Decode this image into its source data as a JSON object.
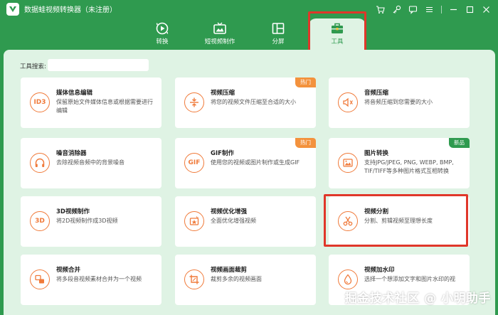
{
  "app": {
    "title": "数据蛙视频转换器（未注册）",
    "window_controls": [
      "cart-icon",
      "key-icon",
      "chat-icon",
      "menu-icon",
      "minimize-icon",
      "maximize-icon",
      "close-icon"
    ]
  },
  "nav": {
    "tabs": [
      {
        "label": "转换",
        "icon": "convert-icon",
        "active": false
      },
      {
        "label": "短视频制作",
        "icon": "tv-icon",
        "active": false
      },
      {
        "label": "分屏",
        "icon": "split-screen-icon",
        "active": false
      },
      {
        "label": "工具",
        "icon": "toolbox-icon",
        "active": true
      }
    ]
  },
  "search": {
    "label": "工具搜索:",
    "value": ""
  },
  "tools": [
    {
      "title": "媒体信息编辑",
      "desc": "保留原始文件媒体信息或根据需要进行编辑",
      "icon": "id3-icon",
      "icon_text": "ID3",
      "badge": ""
    },
    {
      "title": "视频压缩",
      "desc": "将您的视频文件压缩至合适的大小",
      "icon": "compress-icon",
      "icon_text": "",
      "badge": "热门"
    },
    {
      "title": "音频压缩",
      "desc": "将音频压缩到您需要的大小",
      "icon": "audio-compress-icon",
      "icon_text": "",
      "badge": ""
    },
    {
      "title": "噪音消除器",
      "desc": "去除视频音频中的背景噪音",
      "icon": "headphones-icon",
      "icon_text": "",
      "badge": ""
    },
    {
      "title": "GIF制作",
      "desc": "使用您的视频或图片制作或生成GIF",
      "icon": "gif-icon",
      "icon_text": "GIF",
      "badge": "热门"
    },
    {
      "title": "图片转换",
      "desc": "支持JPG/JPEG, PNG, WEBP, BMP, TIF/TIFF等多种图片格式互相转换",
      "icon": "image-convert-icon",
      "icon_text": "",
      "badge": "新品"
    },
    {
      "title": "3D视频制作",
      "desc": "将2D视频制作成3D视频",
      "icon": "3d-icon",
      "icon_text": "3D",
      "badge": ""
    },
    {
      "title": "视频优化增强",
      "desc": "全面优化增强视频",
      "icon": "enhance-icon",
      "icon_text": "",
      "badge": ""
    },
    {
      "title": "视频分割",
      "desc": "分割、剪辑视频至理想长度",
      "icon": "scissors-icon",
      "icon_text": "",
      "badge": ""
    },
    {
      "title": "视频合并",
      "desc": "将多段音视频素材合并为一个视频",
      "icon": "merge-icon",
      "icon_text": "",
      "badge": ""
    },
    {
      "title": "视频画面裁剪",
      "desc": "裁剪多余的视频画面",
      "icon": "crop-icon",
      "icon_text": "",
      "badge": ""
    },
    {
      "title": "视频加水印",
      "desc": "选择一个想添加文字和图片水印的视",
      "icon": "watermark-icon",
      "icon_text": "",
      "badge": ""
    }
  ],
  "watermark": "掘金技术社区 @ 小明助手",
  "colors": {
    "brand": "#2f9a4f",
    "panel": "#dff3e4",
    "accent_orange": "#f07a3a",
    "highlight_red": "#e0372a"
  }
}
